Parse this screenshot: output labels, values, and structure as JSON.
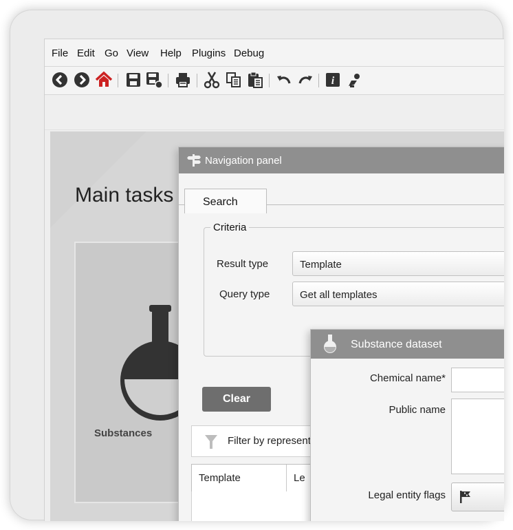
{
  "menubar": {
    "items": [
      "File",
      "Edit",
      "Go",
      "View",
      "Help",
      "Plugins",
      "Debug"
    ]
  },
  "toolbar": {
    "icons": [
      "back-icon",
      "forward-icon",
      "home-icon",
      "save-icon",
      "save-as-icon",
      "print-icon",
      "cut-icon",
      "copy-icon",
      "paste-icon",
      "undo-icon",
      "redo-icon",
      "info-icon",
      "user-icon"
    ],
    "home_color": "#cc2222",
    "icon_color": "#333333"
  },
  "main": {
    "title": "Main tasks",
    "card_label": "Substances"
  },
  "nav_panel": {
    "title": "Navigation panel",
    "tab": "Search",
    "criteria_legend": "Criteria",
    "result_type_label": "Result type",
    "result_type_value": "Template",
    "query_type_label": "Query type",
    "query_type_value": "Get all templates",
    "clear_label": "Clear",
    "filter_label": "Filter by representative",
    "columns": [
      "Template",
      "Le"
    ]
  },
  "substance_panel": {
    "title": "Substance dataset",
    "chemical_name_label": "Chemical name*",
    "public_name_label": "Public name",
    "legal_entity_flags_label": "Legal entity flags"
  },
  "colors": {
    "header_bg": "#8f8f8f",
    "clear_bg": "#6e6e6e",
    "main_area_bg": "#d6d6d6"
  }
}
